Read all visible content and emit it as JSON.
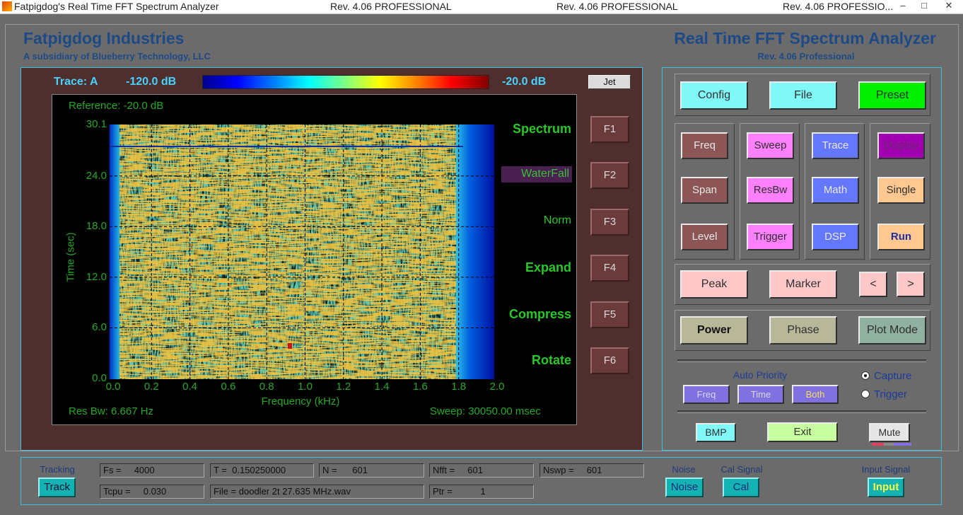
{
  "titlebar": {
    "title": "Fatpigdog's Real Time FFT Spectrum Analyzer",
    "rev1": "Rev.  4.06   PROFESSIONAL",
    "rev2": "Rev.  4.06   PROFESSIONAL",
    "rev3": "Rev.  4.06   PROFESSIO...",
    "minimize": "–",
    "maximize": "□",
    "close": "✕"
  },
  "header": {
    "company": "Fatpigdog Industries",
    "subsidiary": "A subsidiary of Blueberry Technology, LLC",
    "app_title": "Real Time FFT Spectrum Analyzer",
    "revision": "Rev. 4.06  Professional"
  },
  "waterfall": {
    "trace_label": "Trace: A",
    "min_db": "-120.0 dB",
    "max_db": "-20.0 dB",
    "colormap_button": "Jet",
    "reference": "Reference:  -20.0 dB",
    "res_bw": "Res Bw:  6.667 Hz",
    "sweep": "Sweep:  30050.00 msec",
    "xlabel": "Frequency (kHz)",
    "ylabel": "Time (sec)",
    "x_ticks": [
      "0.0",
      "0.2",
      "0.4",
      "0.6",
      "0.8",
      "1.0",
      "1.2",
      "1.4",
      "1.6",
      "1.8",
      "2.0"
    ],
    "y_ticks": [
      "30.1",
      "24.0",
      "18.0",
      "12.0",
      "6.0",
      "0.0"
    ],
    "x_range": [
      0,
      2.0
    ],
    "y_range": [
      0,
      30.1
    ],
    "colormap": [
      "#00008f",
      "#0000ff",
      "#00ffff",
      "#ffff00",
      "#ff0000",
      "#800000"
    ]
  },
  "fkeys": [
    {
      "label": "Spectrum",
      "key": "F1"
    },
    {
      "label": "WaterFall",
      "key": "F2"
    },
    {
      "label": "Norm",
      "key": "F3"
    },
    {
      "label": "Expand",
      "key": "F4"
    },
    {
      "label": "Compress",
      "key": "F5"
    },
    {
      "label": "Rotate",
      "key": "F6"
    }
  ],
  "controls": {
    "config": "Config",
    "file": "File",
    "preset": "Preset",
    "freq": "Freq",
    "span": "Span",
    "level": "Level",
    "sweep": "Sweep",
    "resbw": "ResBw",
    "trigger": "Trigger",
    "trace": "Trace",
    "math": "Math",
    "dsp": "DSP",
    "display": "Display",
    "single": "Single",
    "run": "Run",
    "peak": "Peak",
    "marker": "Marker",
    "prev": "<",
    "next": ">",
    "power": "Power",
    "phase": "Phase",
    "plot_mode": "Plot Mode",
    "auto_priority": "Auto Priority",
    "ap_freq": "Freq",
    "ap_time": "Time",
    "ap_both": "Both",
    "capture": "Capture",
    "trigger_radio": "Trigger",
    "bmp": "BMP",
    "exit": "Exit",
    "mute": "Mute"
  },
  "status": {
    "tracking_label": "Tracking",
    "track_button": "Track",
    "fs": "Fs =     4000",
    "t": "T =  0.150250000",
    "n": "N =      601",
    "nfft": "Nfft =     601",
    "nswp": "Nswp =     601",
    "tcpu": "Tcpu =     0.030",
    "file": "File = doodler 2t 27.635 MHz.wav",
    "ptr": "Ptr =           1",
    "noise_label": "Noise",
    "noise_button": "Noise",
    "cal_label": "Cal Signal",
    "cal_button": "Cal",
    "input_label": "Input Signal",
    "input_button": "Input"
  }
}
